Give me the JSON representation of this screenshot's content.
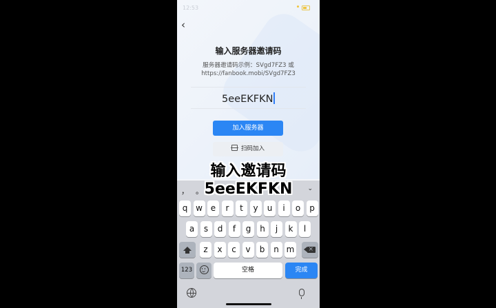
{
  "status": {
    "time": "12:53"
  },
  "page": {
    "title": "输入服务器邀请码",
    "hint_line1": "服务器邀请码示例：SVgd7FZ3 或",
    "hint_line2": "https://fanbook.mobi/SVgd7FZ3",
    "input_value": "5eeEKFKN",
    "join_label": "加入服务器",
    "scan_label": "扫码加入"
  },
  "caption": {
    "line1": "输入邀请码",
    "line2": "5eeEKFKN"
  },
  "keyboard": {
    "candidates": [
      "，",
      "。",
      "？"
    ],
    "row1": [
      "q",
      "w",
      "e",
      "r",
      "t",
      "y",
      "u",
      "i",
      "o",
      "p"
    ],
    "row2": [
      "a",
      "s",
      "d",
      "f",
      "g",
      "h",
      "j",
      "k",
      "l"
    ],
    "row3": [
      "z",
      "x",
      "c",
      "v",
      "b",
      "n",
      "m"
    ],
    "num_label": "123",
    "space_label": "空格",
    "done_label": "完成"
  },
  "colors": {
    "accent": "#2b86f4",
    "keyboard_bg": "#d3d5db"
  }
}
